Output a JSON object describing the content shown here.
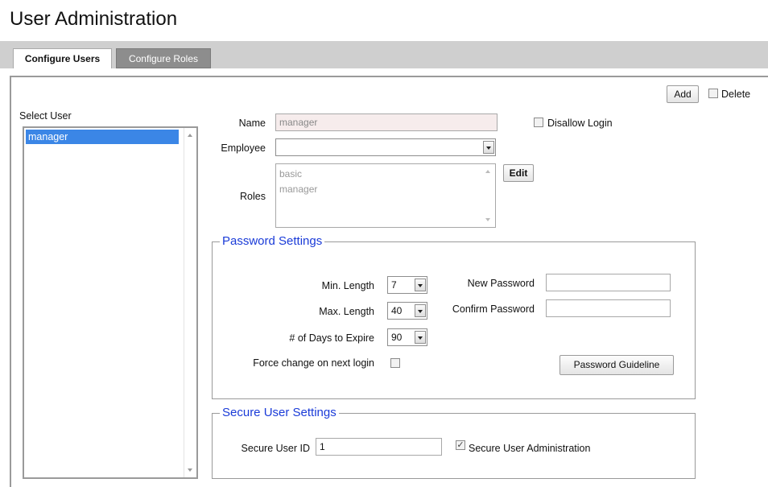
{
  "page_title": "User Administration",
  "tabs": [
    {
      "label": "Configure Users",
      "active": true
    },
    {
      "label": "Configure Roles",
      "active": false
    }
  ],
  "toolbar": {
    "add_label": "Add",
    "delete_label": "Delete"
  },
  "user_list": {
    "label": "Select User",
    "items": [
      "manager"
    ],
    "selected": "manager"
  },
  "form": {
    "name_label": "Name",
    "name_value": "manager",
    "disallow_login_label": "Disallow Login",
    "employee_label": "Employee",
    "employee_value": "",
    "roles_label": "Roles",
    "roles": [
      "basic",
      "manager"
    ],
    "edit_label": "Edit"
  },
  "password_settings": {
    "legend": "Password Settings",
    "min_length_label": "Min. Length",
    "min_length_value": "7",
    "max_length_label": "Max. Length",
    "max_length_value": "40",
    "days_expire_label": "# of Days to Expire",
    "days_expire_value": "90",
    "force_change_label": "Force change on next login",
    "new_password_label": "New Password",
    "confirm_password_label": "Confirm Password",
    "guideline_label": "Password Guideline"
  },
  "secure_settings": {
    "legend": "Secure User Settings",
    "user_id_label": "Secure User ID",
    "user_id_value": "1",
    "secure_admin_label": "Secure User Administration",
    "secure_admin_checked": true
  },
  "colors": {
    "legend": "#1a3bd8",
    "selection": "#3b86e6",
    "tabbar": "#cfcfcf"
  }
}
